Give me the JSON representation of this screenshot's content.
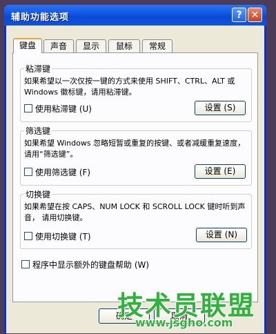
{
  "window": {
    "title": "辅助功能选项",
    "help_glyph": "?",
    "close_glyph": "✕"
  },
  "tabs": [
    "键盘",
    "声音",
    "显示",
    "鼠标",
    "常规"
  ],
  "groups": {
    "sticky": {
      "title": "粘滞键",
      "description": "如果希望以一次仅按一键的方式来使用 SHIFT、CTRL、ALT 或 Windows 徽标键，请用粘滞键。",
      "checkbox_label": "使用粘滞键 (U)",
      "button_label": "设置 (S)"
    },
    "filter": {
      "title": "筛选键",
      "description": "如果希望 Windows 忽略短暂或重复的按键、或者减缓重复速度，请用“筛选键”。",
      "checkbox_label": "使用筛选键 (F)",
      "button_label": "设置 (E)"
    },
    "toggle": {
      "title": "切换键",
      "description": "如果希望在按 CAPS、NUM LOCK 和 SCROLL LOCK 键时听到声音， 请用切换键。",
      "checkbox_label": "使用切换键 (T)",
      "button_label": "设置 (N)"
    }
  },
  "extra_help_label": "程序中显示额外的键盘帮助 (W)",
  "bottom_buttons": {
    "ok": "确定",
    "cancel": "取消"
  },
  "watermark": {
    "main": "技术员联盟",
    "url": "www.jsgho.com"
  }
}
